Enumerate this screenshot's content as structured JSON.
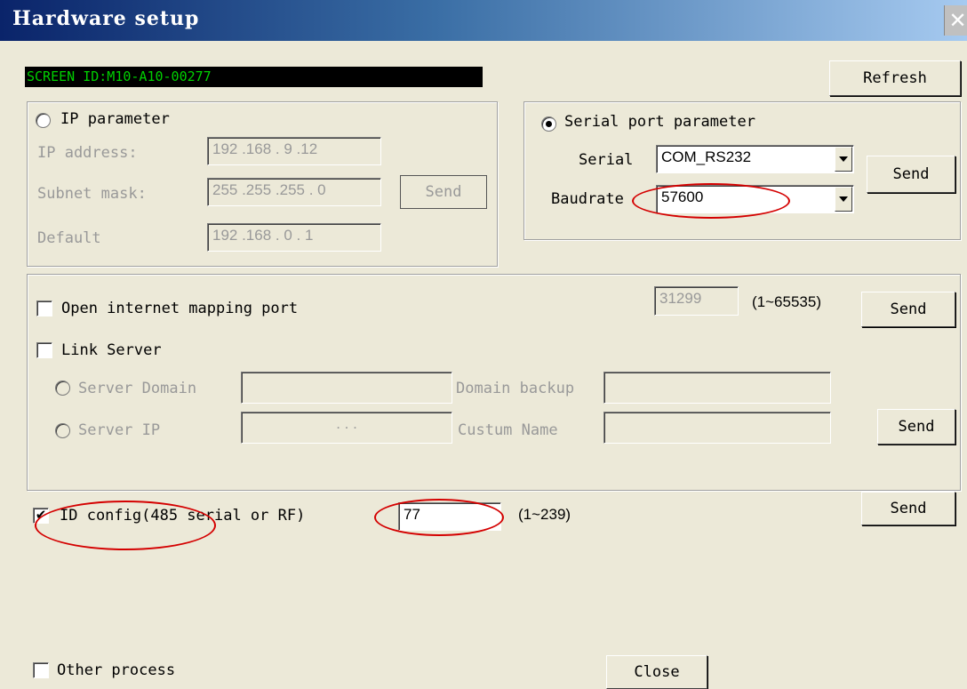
{
  "window": {
    "title": "Hardware setup"
  },
  "screen_id": "SCREEN ID:M10-A10-00277",
  "buttons": {
    "refresh": "Refresh",
    "ip_send": "Send",
    "serial_send": "Send",
    "mapping_send": "Send",
    "server_send": "Send",
    "id_send": "Send",
    "close": "Close"
  },
  "ip_group": {
    "title": "IP parameter",
    "ip_label": "IP address:",
    "ip_value": "192 .168 . 9  .12",
    "mask_label": "Subnet mask:",
    "mask_value": "255 .255 .255 . 0",
    "gateway_label": "Default",
    "gateway_value": "192 .168 . 0  . 1"
  },
  "serial_group": {
    "title": "Serial port parameter",
    "serial_label": "Serial",
    "serial_value": "COM_RS232",
    "baud_label": "Baudrate",
    "baud_value": "57600"
  },
  "network": {
    "mapping_label": "Open internet mapping port",
    "mapping_port": "31299",
    "mapping_range": "(1~65535)",
    "link_server_label": "Link Server",
    "server_domain_label": "Server Domain",
    "domain_backup_label": "Domain backup",
    "server_ip_label": "Server IP",
    "server_ip_value": ".   .   .",
    "custom_name_label": "Custum Name"
  },
  "id_config": {
    "label": "ID config(485 serial or RF)",
    "value": "77",
    "range": "(1~239)"
  },
  "other_process": "Other process",
  "colors": {
    "annotation": "#d40000",
    "screen_id_text": "#00d000"
  }
}
